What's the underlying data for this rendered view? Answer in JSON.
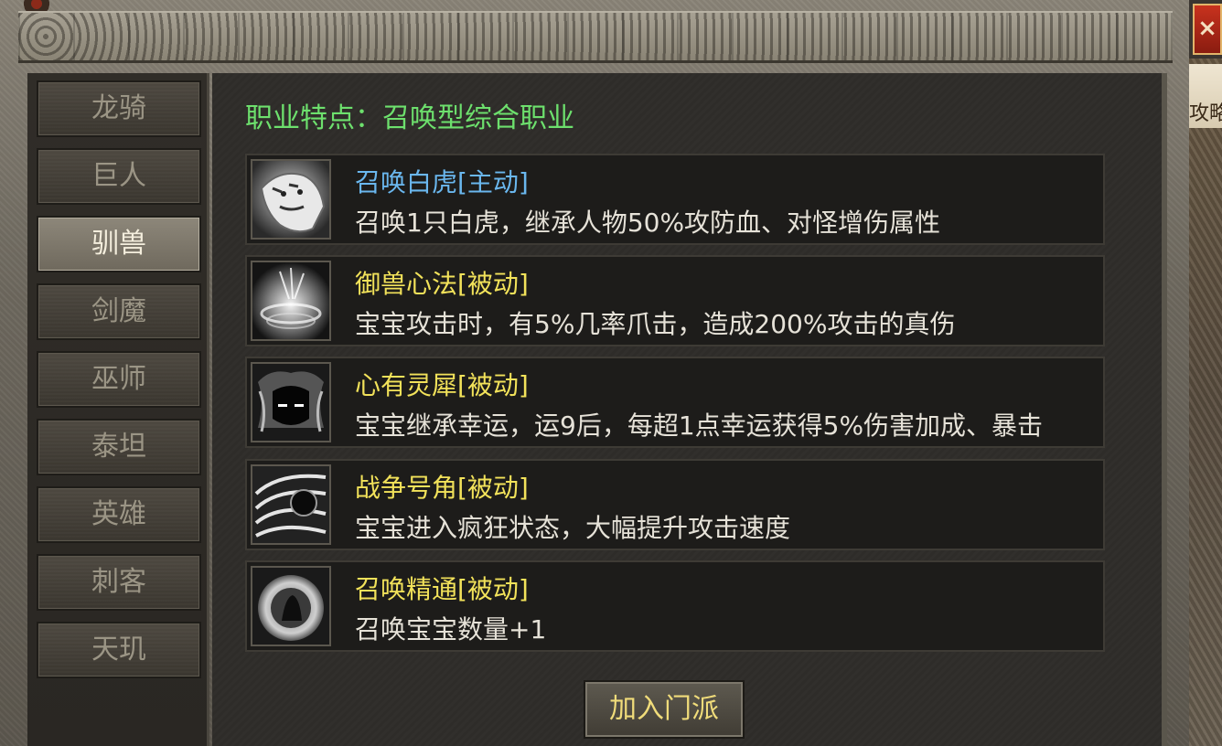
{
  "window": {
    "close_label": "×"
  },
  "background": {
    "right_tab_text": "攻略"
  },
  "sidebar": {
    "items": [
      {
        "label": "龙骑",
        "active": false
      },
      {
        "label": "巨人",
        "active": false
      },
      {
        "label": "驯兽",
        "active": true
      },
      {
        "label": "剑魔",
        "active": false
      },
      {
        "label": "巫师",
        "active": false
      },
      {
        "label": "泰坦",
        "active": false
      },
      {
        "label": "英雄",
        "active": false
      },
      {
        "label": "刺客",
        "active": false
      },
      {
        "label": "天玑",
        "active": false
      }
    ]
  },
  "main": {
    "feature_text": "职业特点：召唤型综合职业",
    "skills": [
      {
        "name": "召唤白虎[主动]",
        "desc": "召唤1只白虎，继承人物50%攻防血、对怪增伤属性",
        "name_color": "#6ab7ee",
        "icon": "white-tiger-icon"
      },
      {
        "name": "御兽心法[被动]",
        "desc": "宝宝攻击时，有5%几率爪击，造成200%攻击的真伤",
        "name_color": "#f2e25a",
        "icon": "beast-mind-icon"
      },
      {
        "name": "心有灵犀[被动]",
        "desc": "宝宝继承幸运，运9后，每超1点幸运获得5%伤害加成、暴击",
        "name_color": "#f2e25a",
        "icon": "spirit-link-icon"
      },
      {
        "name": "战争号角[被动]",
        "desc": "宝宝进入疯狂状态，大幅提升攻击速度",
        "name_color": "#f2e25a",
        "icon": "war-horn-icon"
      },
      {
        "name": "召唤精通[被动]",
        "desc": "召唤宝宝数量+1",
        "name_color": "#f2e25a",
        "icon": "summon-mastery-icon"
      }
    ],
    "join_button": "加入门派"
  }
}
